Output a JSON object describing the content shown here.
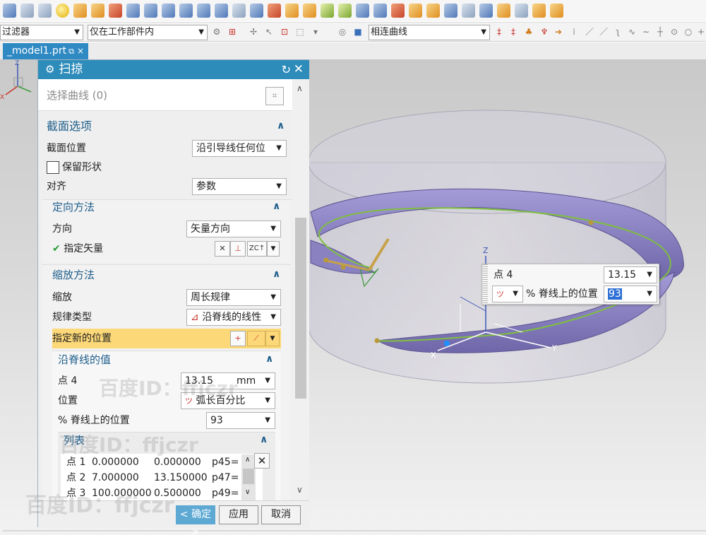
{
  "toolbar1": {
    "icons": [
      "block-icon",
      "cylinder-icon",
      "cone-icon",
      "sphere-icon",
      "tube-icon",
      "thicken-icon",
      "nx5-icon",
      "extrude-icon",
      "revolve-icon",
      "sweep-icon",
      "shell-icon",
      "trim-icon",
      "bridge-icon",
      "offset-icon",
      "face-icon",
      "draft-icon",
      "chamfer-icon",
      "pattern-icon",
      "curve-icon",
      "point-icon",
      "book-icon",
      "mirror-icon",
      "fold-icon",
      "sheet-icon",
      "unfold-icon",
      "plate-icon",
      "measure-icon",
      "view-icon",
      "box-icon",
      "stack-icon",
      "edit-icon",
      "note-icon"
    ]
  },
  "toolbar2": {
    "filter": "过滤器",
    "scope": "仅在工作部件内",
    "curve_rule": "相连曲线"
  },
  "tab": {
    "label": "_model1.prt"
  },
  "dialog": {
    "title": "扫掠",
    "select_curve": "选择曲线 (0)",
    "section_options": {
      "header": "截面选项",
      "position_label": "截面位置",
      "position_value": "沿引导线任何位",
      "preserve_shape": "保留形状",
      "align_label": "对齐",
      "align_value": "参数"
    },
    "orientation": {
      "header": "定向方法",
      "direction_label": "方向",
      "direction_value": "矢量方向",
      "specify_vector": "指定矢量"
    },
    "scaling": {
      "header": "缩放方法",
      "scale_label": "缩放",
      "scale_value": "周长规律",
      "law_type_label": "规律类型",
      "law_type_value": "沿脊线的线性",
      "new_position_label": "指定新的位置"
    },
    "spine_values": {
      "header": "沿脊线的值",
      "point_label": "点 4",
      "point_value": "13.15",
      "unit": "mm",
      "location_label": "位置",
      "location_value": "弧长百分比",
      "percent_label": "% 脊线上的位置",
      "percent_value": "93"
    },
    "list": {
      "header": "列表",
      "rows": [
        {
          "point": "点 1",
          "a": "0.000000",
          "b": "0.000000",
          "p": "p45="
        },
        {
          "point": "点 2",
          "a": "7.000000",
          "b": "13.150000",
          "p": "p47="
        },
        {
          "point": "点 3",
          "a": "100.000000",
          "b": "0.500000",
          "p": "p49="
        }
      ]
    },
    "buttons": {
      "ok": "< 确定 >",
      "apply": "应用",
      "cancel": "取消"
    }
  },
  "onscreen_input": {
    "point_label": "点 4",
    "point_value": "13.15",
    "percent_label": "% 脊线上的位置",
    "percent_value": "93"
  },
  "viewport": {
    "axis_z": "Z",
    "axis_x": "X",
    "axis_y": "Y",
    "triad_z": "Z",
    "triad_x": "X"
  },
  "watermarks": [
    "百度ID：ffjczr",
    "百度ID：ffjczr",
    "百度ID：ffjczr"
  ],
  "colors": {
    "title_bar": "#2e8cba",
    "highlight_row": "#fcd878",
    "tab_active": "#2f8ac4",
    "sweep_body": "#8b82c2",
    "guide_curve": "#7fbf3f"
  }
}
